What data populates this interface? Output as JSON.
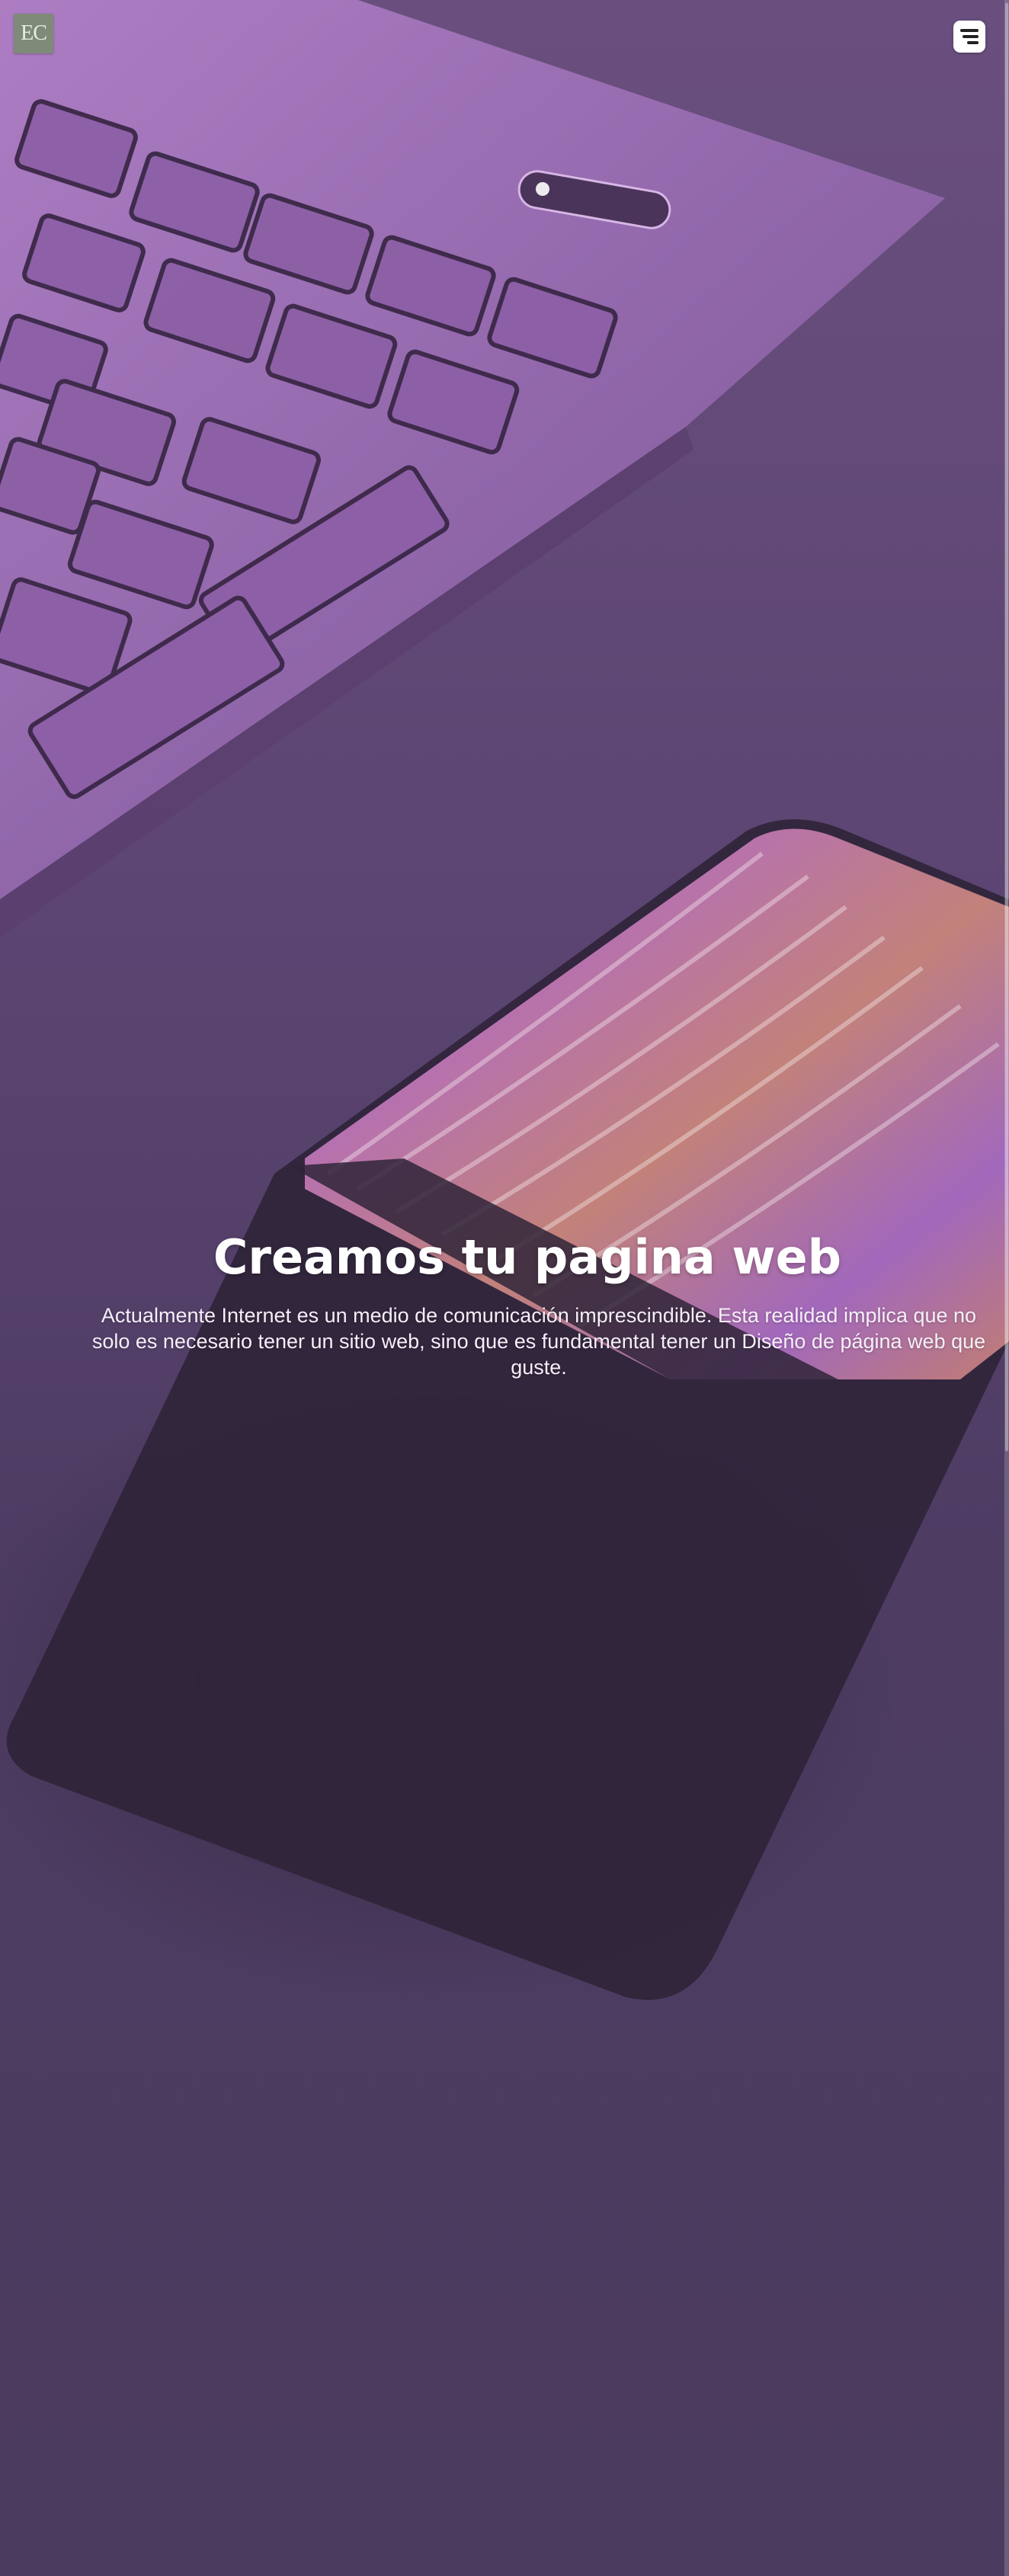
{
  "header": {
    "logo_text": "EC",
    "menu_icon": "menu-icon"
  },
  "hero": {
    "title": "Creamos tu pagina web",
    "description": "Actualmente Internet es un medio de comunicación imprescindible. Esta realidad implica que no solo es necesario tener un sitio web, sino que es fundamental tener un Diseño de página web que guste.",
    "background_image": "laptop-keyboard-and-phone-photo"
  },
  "colors": {
    "overlay": "#4a3a5c",
    "accent_purple": "#b07ad0",
    "text": "#ffffff",
    "logo_bg": "#7f8a78"
  }
}
